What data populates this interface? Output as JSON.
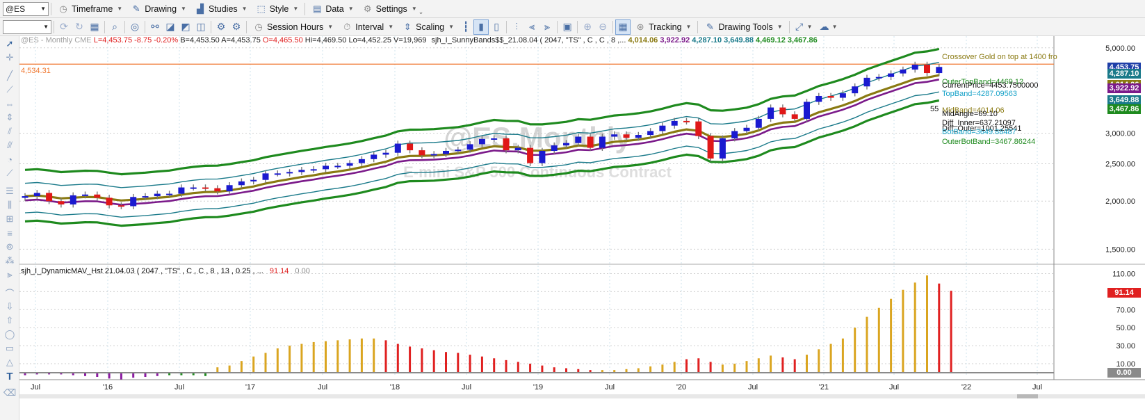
{
  "toolbar1": {
    "symbol": "@ES",
    "timeframe": "Timeframe",
    "drawing": "Drawing",
    "studies": "Studies",
    "style": "Style",
    "data": "Data",
    "settings": "Settings"
  },
  "toolbar2": {
    "session_hours": "Session Hours",
    "interval": "Interval",
    "scaling": "Scaling",
    "tracking": "Tracking",
    "drawing_tools": "Drawing Tools"
  },
  "price_pane": {
    "header_symbol": "@ES - Monthly  CME",
    "ohlc": {
      "L": "L=4,453.75",
      "net": "-8.75",
      "pct": "-0.20%",
      "B": "B=4,453.50",
      "A": "A=4,453.75",
      "O": "O=4,465.50",
      "Hi": "Hi=4,469.50",
      "Lo": "Lo=4,452.25",
      "V": "V=19,969"
    },
    "study_label": "sjh_I_SunnyBands$$_21.08.04 (  2047,  \"TS\" ,  C ,  C ,    8 ,...",
    "study_values": [
      {
        "text": "4,014.06",
        "color": "#8a7a12"
      },
      {
        "text": "3,922.92",
        "color": "#7b1a8a"
      },
      {
        "text": "4,287.10",
        "color": "#1a7a8a"
      },
      {
        "text": "3,649.88",
        "color": "#1a7a8a"
      },
      {
        "text": "4,469.12",
        "color": "#1e8a1e"
      },
      {
        "text": "3,467.86",
        "color": "#1e8a1e"
      }
    ],
    "watermark_title": "@ES,Monthly",
    "watermark_sub": "E-mini S&P 500 Continuous Contract",
    "alert_line_label": "4,534.31",
    "crossover_text": "Crossover Gold on top at 1400 fro",
    "annotations": [
      {
        "text": "OuterTopBand=4469.12",
        "color": "#1e8a1e"
      },
      {
        "text": "CurrentPrice=4453.7500000",
        "color": "#111111"
      },
      {
        "text": "TopBand=4287.09563",
        "color": "#17a2c8"
      },
      {
        "text": "55",
        "color": "#111111"
      },
      {
        "text": "MidBand=4014.06",
        "color": "#8a7a12"
      },
      {
        "text": "MidAngle=69.10",
        "color": "#111111"
      },
      {
        "text": "Diff_Inner=637.21097",
        "color": "#111111"
      },
      {
        "text": "Diff_Outer=1001.25541",
        "color": "#111111"
      },
      {
        "text": "BotBand=3649.88487",
        "color": "#17a2c8"
      },
      {
        "text": "OuterBotBand=3467.86244",
        "color": "#1e8a1e"
      }
    ],
    "axis_ticks": [
      "5,000.00",
      "3,000.00",
      "2,500.00",
      "2,000.00",
      "1,500.00"
    ],
    "badges": [
      {
        "text": "4,453.75",
        "color": "#1f3fa8",
        "value": 4453.75
      },
      {
        "text": "4,287.10",
        "color": "#1a7a8a",
        "value": 4287.1
      },
      {
        "text": "4,014.06",
        "color": "#8a7a12",
        "value": 4014.06
      },
      {
        "text": "3,922.92",
        "color": "#7b1a8a",
        "value": 3922.92
      },
      {
        "text": "3,649.88",
        "color": "#1a7a8a",
        "value": 3649.88
      },
      {
        "text": "3,467.86",
        "color": "#1e8a1e",
        "value": 3467.86
      }
    ]
  },
  "indicator_pane": {
    "label": "sjh_I_DynamicMAV_Hst 21.04.03 ( 2047 , \"TS\" , C , C ,  8 , 13 , 0.25 , ...",
    "value_red": "91.14",
    "value_gray": "0.00",
    "axis_ticks": [
      "110.00",
      "90.00",
      "70.00",
      "50.00",
      "30.00",
      "10.00"
    ],
    "badge_last": {
      "text": "91.14",
      "color": "#e02020"
    },
    "badge_zero": {
      "text": "0.00",
      "color": "#8a8a8a"
    }
  },
  "time_axis": [
    "Jul",
    "'16",
    "Jul",
    "'17",
    "Jul",
    "'18",
    "Jul",
    "'19",
    "Jul",
    "'20",
    "Jul",
    "'21",
    "Jul",
    "'22",
    "Jul"
  ],
  "colors": {
    "up_candle": "#1a1ad0",
    "down_candle": "#e01818",
    "outer_band": "#1e8a1e",
    "inner_band": "#1a7a8a",
    "mid_band": "#8a7a12",
    "purple_band": "#7b1a8a",
    "alert_line": "#f07830",
    "hist_gold": "#daa520",
    "hist_red": "#e02020",
    "hist_purple": "#8a1aa0",
    "hist_green": "#1e8a1e"
  },
  "chart_data": [
    {
      "type": "candlestick",
      "title": "@ES,Monthly",
      "x_start": "2015-06",
      "x_end": "2021-08",
      "ylim": [
        1400,
        5100
      ],
      "y_scale": "log",
      "close": [
        2060,
        2100,
        2000,
        1960,
        2070,
        2080,
        2040,
        1950,
        1940,
        2050,
        2060,
        2090,
        2090,
        2170,
        2170,
        2160,
        2120,
        2200,
        2250,
        2270,
        2360,
        2360,
        2380,
        2410,
        2420,
        2470,
        2470,
        2510,
        2570,
        2640,
        2670,
        2820,
        2710,
        2630,
        2650,
        2700,
        2720,
        2810,
        2900,
        2910,
        2710,
        2750,
        2510,
        2700,
        2790,
        2830,
        2940,
        2750,
        2940,
        2980,
        2920,
        2970,
        3040,
        3140,
        3230,
        3220,
        2950,
        2580,
        2910,
        3040,
        3100,
        3270,
        3500,
        3360,
        3270,
        3620,
        3750,
        3710,
        3810,
        3970,
        4180,
        4200,
        4290,
        4390,
        4520,
        4300,
        4460
      ],
      "bands": {
        "outer_top": 4469.12,
        "top": 4287.1,
        "mid": 4014.06,
        "purple": 3922.92,
        "bot": 3649.88,
        "outer_bot": 3467.86
      }
    },
    {
      "type": "bar",
      "title": "sjh_I_DynamicMAV_Hst 21.04.03",
      "ylim": [
        0,
        115
      ],
      "values": [
        3,
        2,
        2,
        2,
        3,
        4,
        5,
        7,
        8,
        6,
        5,
        4,
        3,
        3,
        3,
        4,
        6,
        8,
        13,
        18,
        22,
        27,
        30,
        32,
        34,
        35,
        36,
        37,
        38,
        38,
        36,
        32,
        29,
        27,
        25,
        23,
        22,
        20,
        18,
        16,
        14,
        12,
        10,
        8,
        6,
        5,
        4,
        3,
        3,
        3,
        4,
        5,
        7,
        9,
        12,
        15,
        16,
        12,
        9,
        10,
        13,
        16,
        19,
        17,
        15,
        20,
        26,
        32,
        38,
        50,
        62,
        72,
        82,
        92,
        100,
        108,
        99,
        91
      ],
      "colors": [
        "p",
        "p",
        "p",
        "p",
        "p",
        "p",
        "p",
        "p",
        "p",
        "p",
        "p",
        "p",
        "g",
        "g",
        "g",
        "g",
        "o",
        "o",
        "o",
        "o",
        "o",
        "o",
        "o",
        "o",
        "o",
        "o",
        "o",
        "o",
        "o",
        "o",
        "r",
        "r",
        "r",
        "r",
        "r",
        "r",
        "r",
        "r",
        "r",
        "r",
        "r",
        "r",
        "r",
        "r",
        "r",
        "r",
        "r",
        "r",
        "o",
        "o",
        "o",
        "o",
        "o",
        "o",
        "o",
        "r",
        "r",
        "r",
        "o",
        "o",
        "o",
        "o",
        "o",
        "r",
        "r",
        "o",
        "o",
        "o",
        "o",
        "o",
        "o",
        "o",
        "o",
        "o",
        "o",
        "o",
        "r",
        "r"
      ],
      "last_value": 91.14
    }
  ]
}
